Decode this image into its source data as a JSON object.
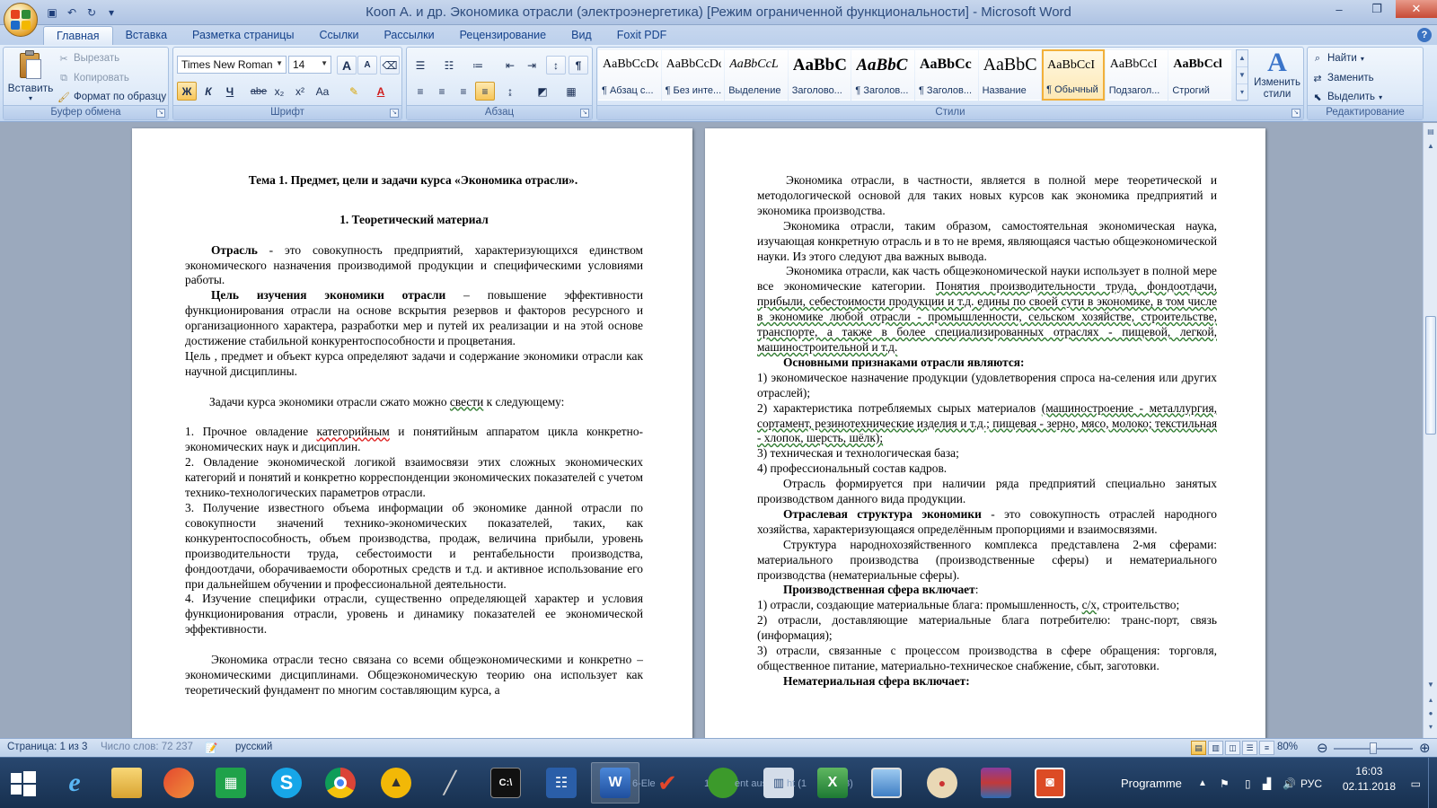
{
  "window": {
    "title": "Кооп А. и др. Экономика отрасли (электроэнергетика) [Режим ограниченной функциональности] - Microsoft Word",
    "controls": {
      "minimize": "–",
      "maximize": "❐",
      "close": "✕"
    }
  },
  "tabs": [
    "Главная",
    "Вставка",
    "Разметка страницы",
    "Ссылки",
    "Рассылки",
    "Рецензирование",
    "Вид",
    "Foxit PDF"
  ],
  "ribbon": {
    "clipboard": {
      "label": "Буфер обмена",
      "paste": "Вставить",
      "cut": "Вырезать",
      "copy": "Копировать",
      "format_painter": "Формат по образцу"
    },
    "font": {
      "label": "Шрифт",
      "font_name": "Times New Roman",
      "font_size": "14",
      "bold": "Ж",
      "italic": "К",
      "underline": "Ч",
      "strike": "abe",
      "subscript": "x₂",
      "superscript": "x²",
      "case": "Aa",
      "grow": "A",
      "shrink": "A"
    },
    "paragraph": {
      "label": "Абзац"
    },
    "styles": {
      "label": "Стили",
      "items": [
        {
          "preview": "AaBbCcDc",
          "name": "¶ Абзац с..."
        },
        {
          "preview": "AaBbCcDc",
          "name": "¶ Без инте..."
        },
        {
          "preview": "AaBbCcL",
          "name": "Выделение"
        },
        {
          "preview": "AaBbC",
          "name": "Заголово..."
        },
        {
          "preview": "AaBbC",
          "name": "¶ Заголов..."
        },
        {
          "preview": "AaBbCc",
          "name": "¶ Заголов..."
        },
        {
          "preview": "AaBbC",
          "name": "Название"
        },
        {
          "preview": "AaBbCcI",
          "name": "¶ Обычный"
        },
        {
          "preview": "AaBbCcI",
          "name": "Подзагол..."
        },
        {
          "preview": "AaBbCcl",
          "name": "Строгий"
        }
      ],
      "change_styles": "Изменить стили"
    },
    "editing": {
      "label": "Редактирование",
      "find": "Найти",
      "replace": "Заменить",
      "select": "Выделить"
    }
  },
  "page_left": {
    "title": "Тема 1. Предмет, цели и задачи курса «Экономика отрасли».",
    "subtitle": "1. Теоретический материал",
    "def_term": "Отрасль",
    "def_text": " -  это  совокупность  предприятий,  характеризующихся единством экономического назначения производимой продукции и специфическими условиями работы.",
    "goal_term": "Цель изучения экономики отрасли",
    "goal_text": " – повышение эффективности функционирования отрасли на основе вскрытия резервов и факторов ресурсного и организационного характера, разработки мер и путей их реализации и на этой основе достижение стабильной конкурентоспособности и процветания.",
    "purpose_a": "Цель",
    "purpose_b": " , предмет и объект курса определяют задачи и содержание экономики отрасли как научной дисциплины.",
    "tasks_a": "Задачи курса экономики отрасли сжато можно ",
    "tasks_u": "свести",
    "tasks_b": " к следующему:",
    "item1_a": " 1. Прочное овладение ",
    "item1_u": "категорийным",
    "item1_b": " и понятийным аппаратом цикла конкретно-экономических наук и дисциплин.",
    "item2": " 2. Овладение экономической логикой взаимосвязи этих сложных экономических категорий и понятий и конкретно корреспонденции экономических показателей с учетом технико-технологических параметров отрасли.",
    "item3": " 3. Получение известного объема информации об экономике данной отрасли по совокупности значений технико-экономических показателей, таких, как конкурентоспособность, объем производства, продаж, величина прибыли, уровень производительности труда, себестоимости и рентабельности производства, фондоотдачи, оборачиваемости  оборотных средств и т.д. и активное использование его при дальнейшем обучении и профессиональной деятельности.",
    "item4": " 4. Изучение специфики отрасли, существенно определяющей характер и условия функционирования отрасли, уровень и динамику показателей ее экономической эффективности.",
    "closing": "Экономика отрасли тесно связана со всеми общеэкономическими и конкретно – экономическими дисциплинами. Общеэкономическую теорию она использует как теоретический фундамент по многим составляющим курса, а"
  },
  "page_right": {
    "p1": "Экономика отрасли, в частности, является в полной мере теоретической и методологической основой для таких новых курсов  как экономика предприятий и экономика производства.",
    "p2": "Экономика отрасли, таким образом, самостоятельная экономическая наука, изучающая конкретную отрасль и в то не время, являющаяся частью общеэкономической науки. Из этого следуют два важных вывода.",
    "p3_a": "Экономика отрасли, как часть общеэкономической науки использует в полной мере все экономические категории. ",
    "p3_u": "Понятия производительности труда, фондоотдачи, прибыли, себестоимости продукции и т.д. едины по своей сути в экономике, в том числе в экономике любой отрасли - промышленности, сельском хозяйстве, строительстве, транспорте, а также в более специализированных отраслях - пищевой, легкой, машиностроительной и т.д.",
    "signs_heading": "Основными признаками отрасли являются:",
    "sign1": "1)  экономическое  назначение  продукции (удовлетворения  спроса  на-селения или других отраслей);",
    "sign2_a": "2)  характеристика  потребляемых  сырых  материалов ",
    "sign2_u": "(машиностроение - металлургия, сортамент, резинотехнические изделия и т.д.; пищевая - зерно, мясо, молоко; текстильная - хлопок, шерсть, шёлк);",
    "sign3": "3)  техническая и технологическая база;",
    "sign4": "4)  профессиональный состав кадров.",
    "p4": "Отрасль  формируется  при  наличии  ряда  предприятий  специально занятых производством данного вида продукции.",
    "struct_term": "Отраслевая структура экономики",
    "struct_text": " - это совокупность отраслей народного  хозяйства,  характеризующаяся  определённым  пропорциями  и взаимосвязями.",
    "p5": "Структура народнохозяйственного комплекса представлена 2-мя сферами: материального  производства  (производственные  сферы)  и  нематериального производства (нематериальные сферы).",
    "prod_heading": "Производственная сфера включает",
    "prod_colon": ":",
    "prod1_a": "1)  отрасли,  создающие  материальные  блага:  промышленность,  ",
    "prod1_u": "с/х",
    "prod1_b": ", строительство;",
    "prod2": "2)  отрасли,  доставляющие материальные  блага  потребителю:  транс-порт, связь (информация);",
    "prod3": "3)  отрасли, связанные с процессом производства в сфере обращения: торговля,  общественное  питание, материально-техническое  снабжение, сбыт, заготовки.",
    "nonprod_heading": "Нематериальная сфера включает:"
  },
  "status": {
    "page": "Страница: 1 из 3",
    "words": "Число слов: 72 237",
    "language": "русский",
    "zoom": "80%",
    "zoom_level": 0.5
  },
  "taskbar": {
    "programme": "Programme",
    "lang": "РУС",
    "time": "16:03",
    "date": "02.11.2018",
    "ghost1": "6-Ele",
    "ghost2": "1 B",
    "ghost3": "ent aus",
    "ghost4": "ht (1",
    "ghost5": "3)"
  }
}
